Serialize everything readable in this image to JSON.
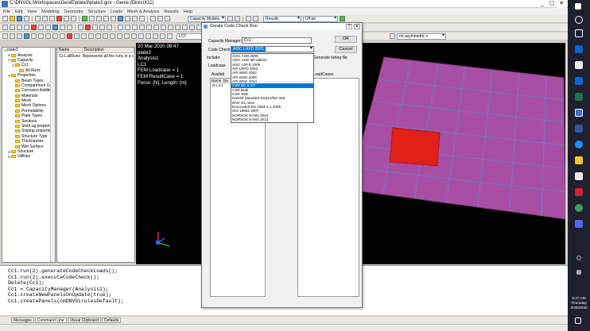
{
  "window": {
    "title": "C:\\DNVGL\\Workspaces\\GeniE\\plate3\\plate3.gnx - Genie (DirectX11)",
    "controls": [
      "_",
      "▢",
      "✕"
    ]
  },
  "menu": [
    "File",
    "Edit",
    "View",
    "Modeling",
    "Geometry",
    "Structure",
    "Loads",
    "Mesh & Analysis",
    "Results",
    "Help"
  ],
  "toolbar": {
    "combo_capacity_models": "Capacity Models",
    "combo_results": "Results",
    "combo_ulf": "Ulf.txt",
    "combo_lc1": "LC1",
    "combo_lc2": "LC1",
    "combo_asym": "no asymmetric s"
  },
  "tree": [
    {
      "exp": "⊟",
      "indent": 0,
      "label": "plate3",
      "icon": "none"
    },
    {
      "exp": "⊞",
      "indent": 1,
      "label": "Analysis",
      "icon": "folder"
    },
    {
      "exp": "⊟",
      "indent": 1,
      "label": "Capacity",
      "icon": "folder"
    },
    {
      "exp": "⊟",
      "indent": 2,
      "label": "Cc1",
      "icon": "folder"
    },
    {
      "exp": "",
      "indent": 3,
      "label": "All Runs",
      "icon": "folder"
    },
    {
      "exp": "⊟",
      "indent": 1,
      "label": "Properties",
      "icon": "folder"
    },
    {
      "exp": "",
      "indent": 2,
      "label": "Beam Types",
      "icon": "folder"
    },
    {
      "exp": "",
      "indent": 2,
      "label": "Compartment Con",
      "icon": "folder"
    },
    {
      "exp": "",
      "indent": 2,
      "label": "Corrosion Addition",
      "icon": "folder"
    },
    {
      "exp": "",
      "indent": 2,
      "label": "Materials",
      "icon": "folder"
    },
    {
      "exp": "",
      "indent": 2,
      "label": "Mesh",
      "icon": "folder"
    },
    {
      "exp": "",
      "indent": 2,
      "label": "Mesh Options",
      "icon": "folder"
    },
    {
      "exp": "",
      "indent": 2,
      "label": "Permeability",
      "icon": "folder"
    },
    {
      "exp": "",
      "indent": 2,
      "label": "Plate Types",
      "icon": "folder"
    },
    {
      "exp": "",
      "indent": 2,
      "label": "Sections",
      "icon": "folder"
    },
    {
      "exp": "",
      "indent": 2,
      "label": "Slot/Lug properties",
      "icon": "folder"
    },
    {
      "exp": "",
      "indent": 2,
      "label": "Sniping properties",
      "icon": "folder"
    },
    {
      "exp": "",
      "indent": 2,
      "label": "Structure Type",
      "icon": "folder"
    },
    {
      "exp": "",
      "indent": 2,
      "label": "Thicknesses",
      "icon": "folder"
    },
    {
      "exp": "",
      "indent": 2,
      "label": "Wet Surface",
      "icon": "folder"
    },
    {
      "exp": "⊞",
      "indent": 1,
      "label": "Structure",
      "icon": "folder"
    },
    {
      "exp": "⊞",
      "indent": 1,
      "label": "Utilities",
      "icon": "folder"
    }
  ],
  "list": {
    "headers": [
      "Name",
      "Description"
    ],
    "rows": [
      [
        "Cc1.allRuns",
        "Represents all the runs in a c"
      ]
    ]
  },
  "viewport": {
    "lines": [
      "20 Mar 2020 08:47",
      "plate3",
      "Analysis1",
      "LC1",
      "FEM Loadcase = 1",
      "FEM ResultCase = 1",
      "Force: [N], Length: [m]"
    ],
    "plate_color": "#a84fa5",
    "highlight_color": "#e0201a"
  },
  "dialog": {
    "title": "Create Code Check Run",
    "help": "?",
    "close": "✕",
    "capacity_label": "Capacity Manager:",
    "capacity_value": "Cc1",
    "code_label": "Code Check:",
    "code_value": "AISC LRFD 2005",
    "include_label": "Include:",
    "ok": "OK",
    "cancel": "Cancel",
    "generate_label": "Generate listing file",
    "loadcase_label": "Loadcase",
    "available_label": "Availab",
    "loadcases_label": "LoadCases",
    "tab_name": "Name",
    "tab_de": "De",
    "tree_fragment": "LC1",
    "options": [
      "AISC ASD 2005",
      "AISC ASD 9th edition",
      "AISC LRFD 2005",
      "API LRFD 2003",
      "API WSD 2002",
      "API WSD 2005",
      "API WSD 2014",
      "CSR BC & OT",
      "CSR Bulk",
      "CSR Tank",
      "Danish Standard DS412/DS 449",
      "DNV GL rules",
      "Eurocode3 EN 1993-1-1 2005",
      "ISO 19902 2007",
      "NORSOK N-004 2004",
      "NORSOK N-004 2013"
    ],
    "selected_option": 7
  },
  "command": {
    "lines": [
      "Cc1.run(2).generateCodeCheckLoads();",
      "Cc1.run(2).executeCodeCheck();",
      "Delete(Cc1);",
      "Cc1 = CapacityManager(Analysis1);",
      "Cc1.createNewPanelsOnUpdate(true);",
      "Cc1.createPanels(cmDNVGLrulesDefault);"
    ]
  },
  "tabs": [
    "Messages",
    "Command Line",
    "Visual Clipboard",
    "Defaults"
  ],
  "taskbar": {
    "time": "8:47 AM",
    "day": "Thursday",
    "date": "3/26/2020"
  }
}
